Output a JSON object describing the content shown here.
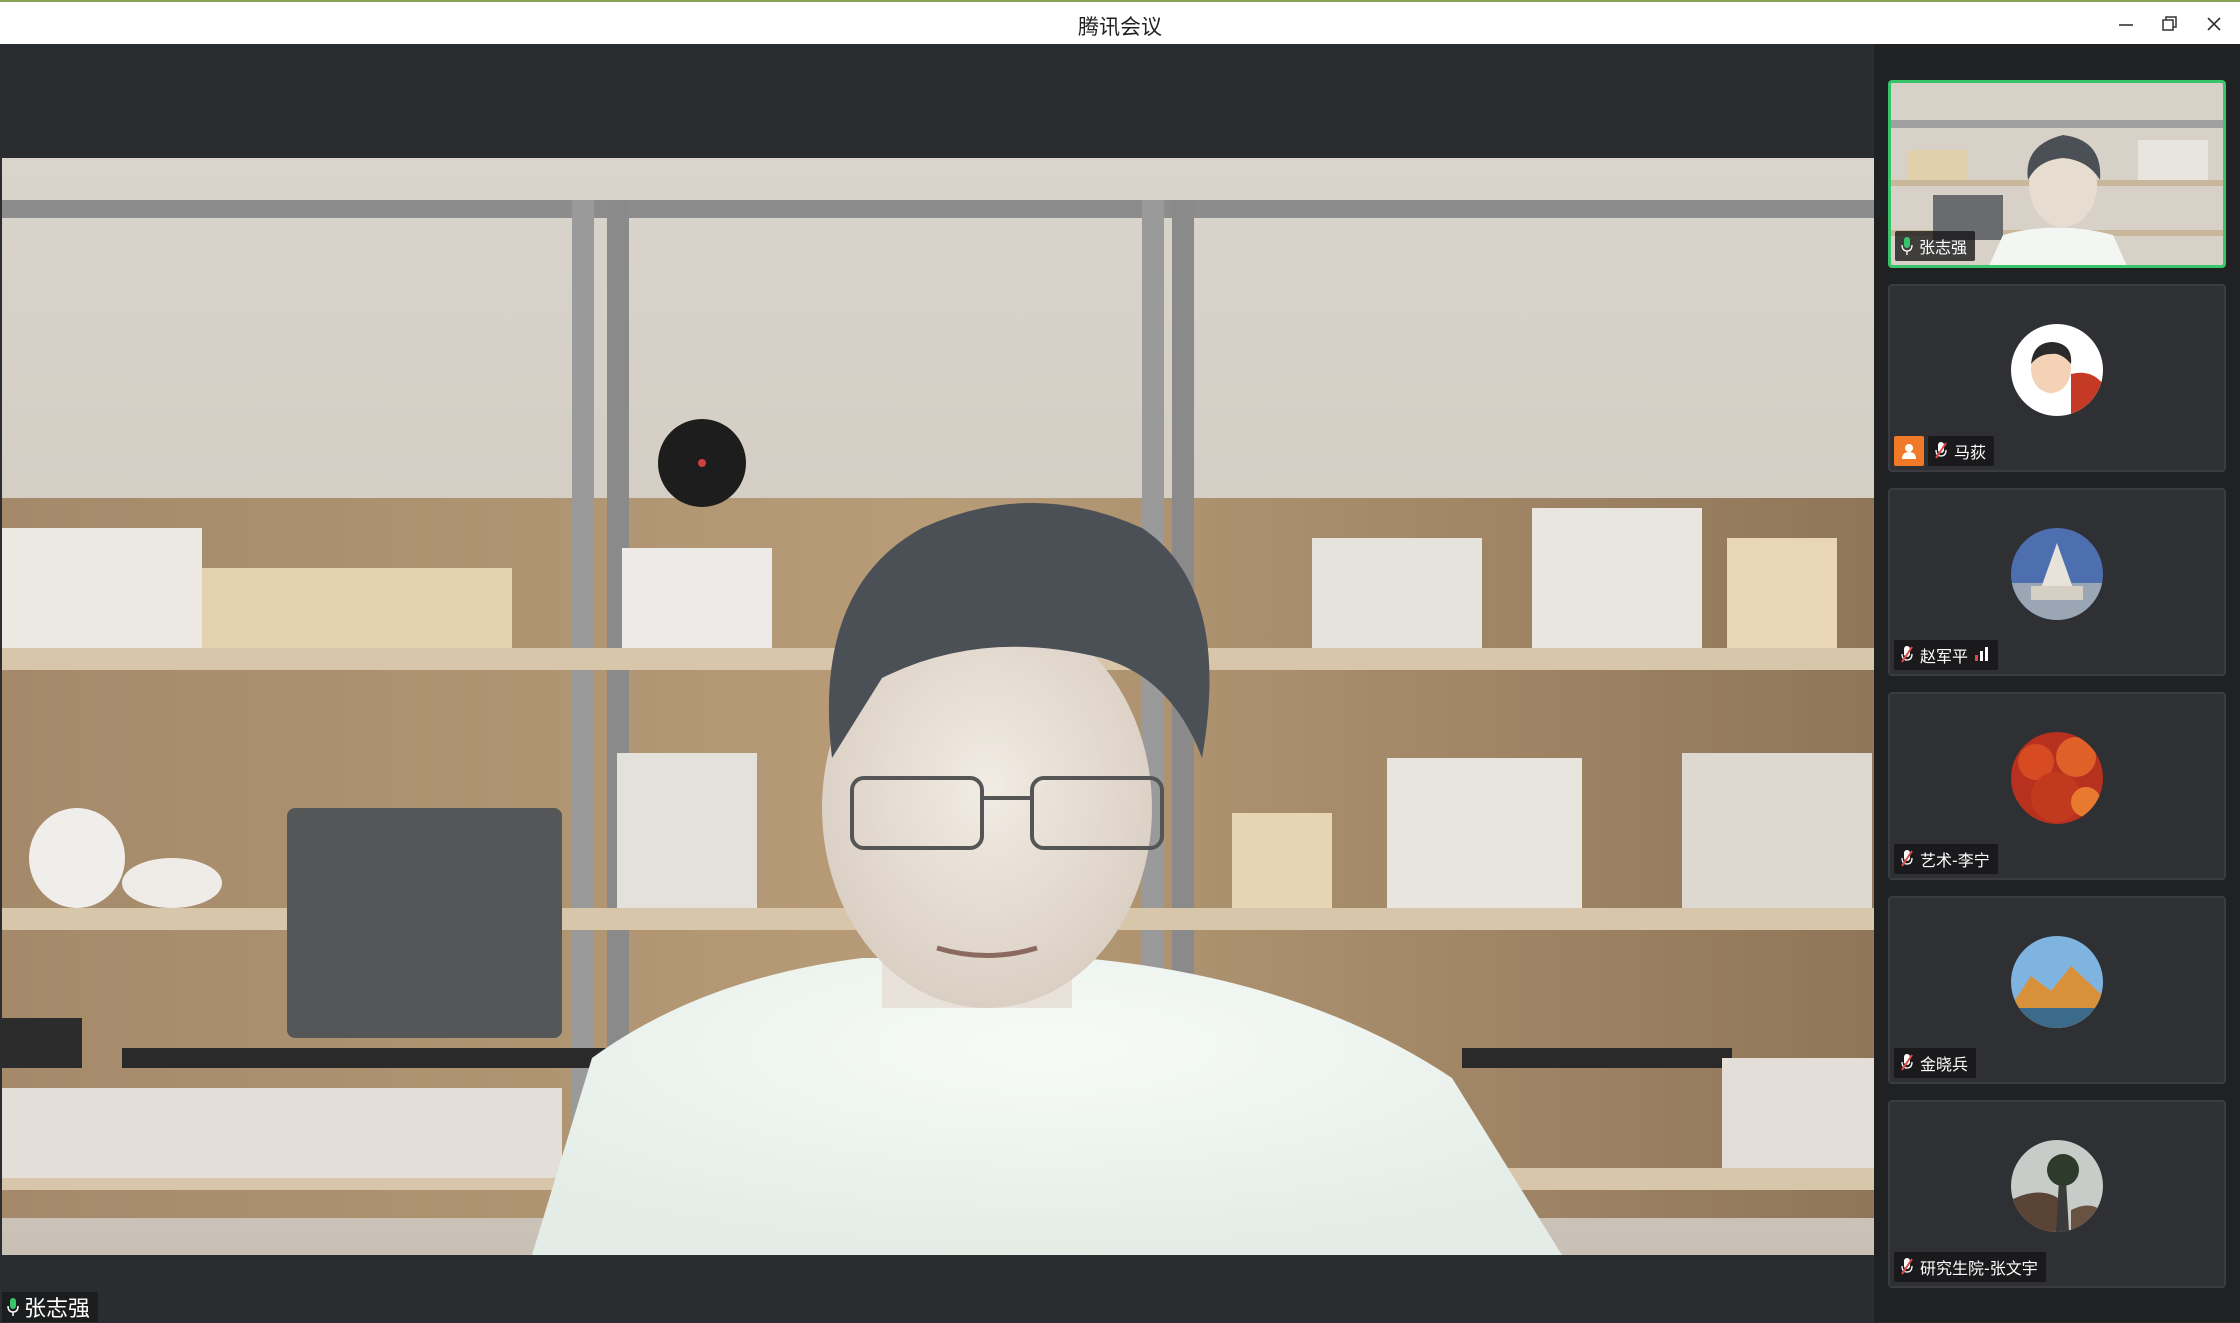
{
  "window": {
    "title": "腾讯会议",
    "controls": [
      "minimize-icon",
      "restore-icon",
      "close-icon"
    ]
  },
  "main_view": {
    "speaker_name": "张志强",
    "speaker_mic": "mic-on-icon"
  },
  "participants": [
    {
      "name": "张志强",
      "mic": "mic-on-icon",
      "avatar": "video",
      "active": true
    },
    {
      "name": "马荻",
      "mic": "mic-off-icon",
      "avatar": "cartoon-person-avatar",
      "host": true
    },
    {
      "name": "赵军平",
      "mic": "mic-off-icon",
      "avatar": "tower-landscape-avatar",
      "signal": "signal-bars-icon"
    },
    {
      "name": "艺术-李宁",
      "mic": "mic-off-icon",
      "avatar": "red-foliage-avatar"
    },
    {
      "name": "金晓兵",
      "mic": "mic-off-icon",
      "avatar": "mountain-sunset-avatar"
    },
    {
      "name": "研究生院-张文宇",
      "mic": "mic-off-icon",
      "avatar": "tree-rock-avatar"
    }
  ],
  "colors": {
    "active_border": "#38c46b",
    "host_badge": "#f07a28",
    "mic_on": "#38c46b",
    "mic_off": "#e04848",
    "signal": "#e04848"
  }
}
